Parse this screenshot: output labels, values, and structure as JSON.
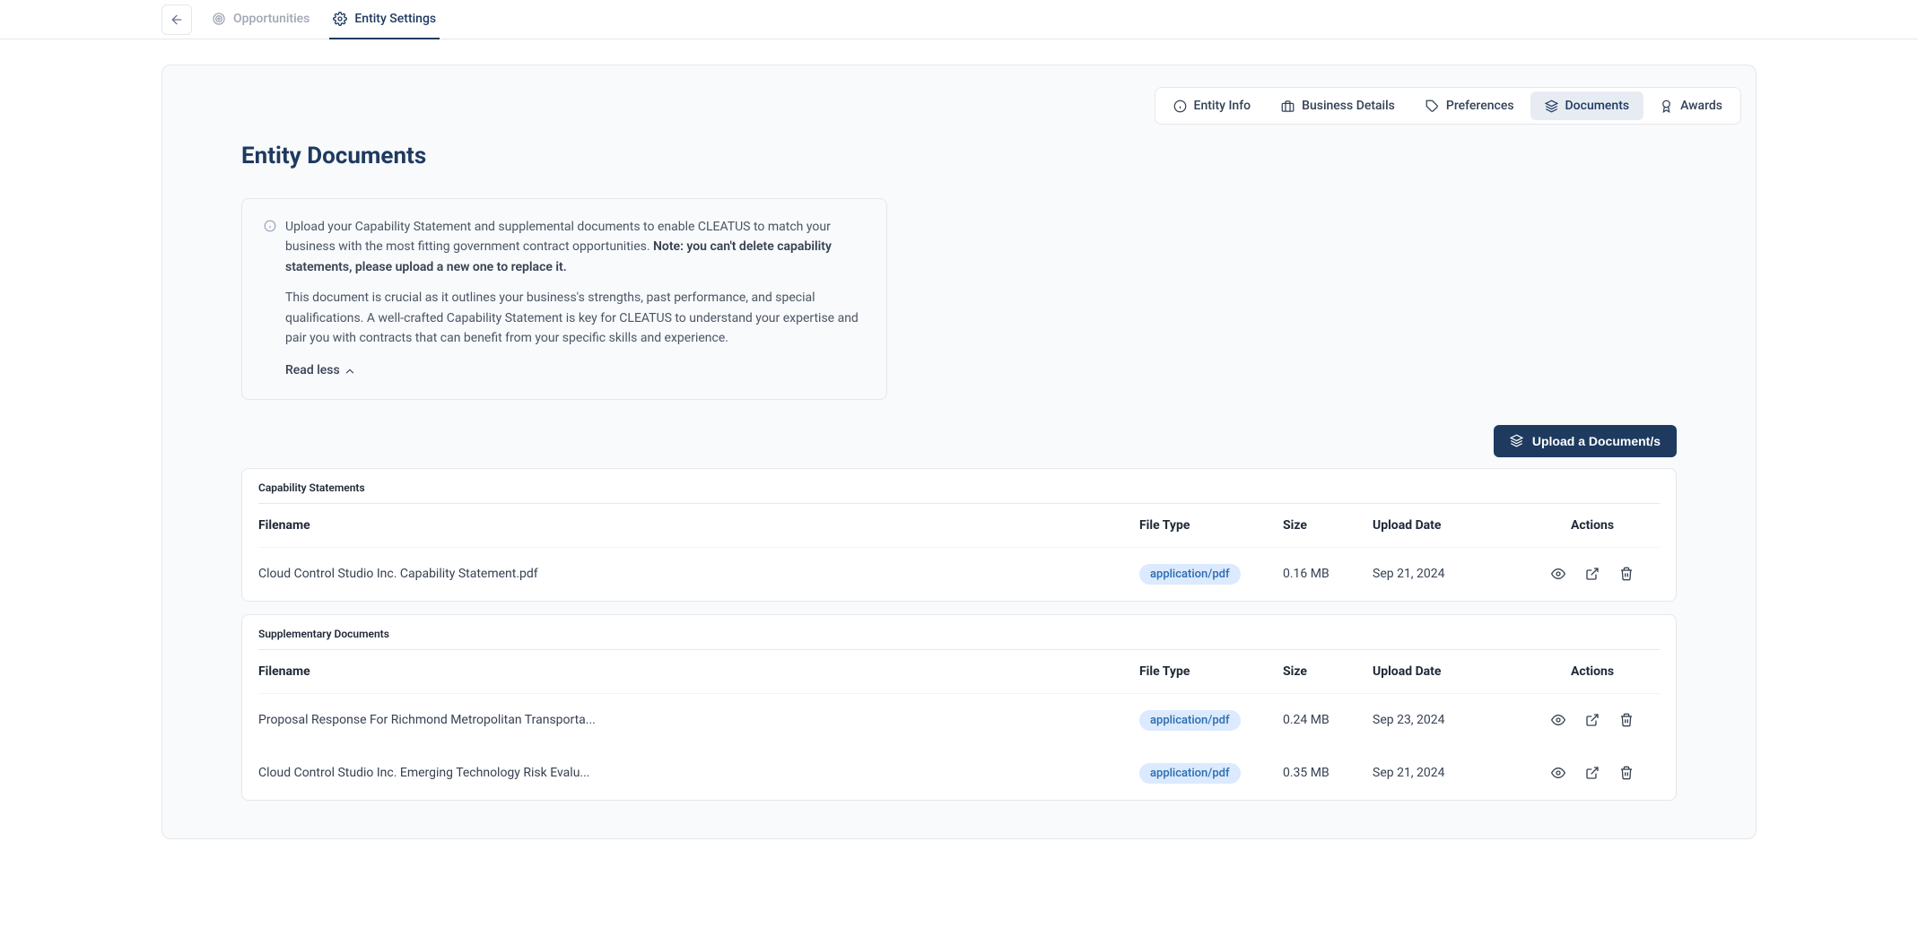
{
  "nav": {
    "opportunities": "Opportunities",
    "entity_settings": "Entity Settings"
  },
  "subnav": {
    "entity_info": "Entity Info",
    "business_details": "Business Details",
    "preferences": "Preferences",
    "documents": "Documents",
    "awards": "Awards"
  },
  "page_title": "Entity Documents",
  "info": {
    "para1_a": "Upload your Capability Statement and supplemental documents to enable CLEATUS to match your business with the most fitting government contract opportunities. ",
    "para1_b": "Note: you can't delete capability statements, please upload a new one to replace it.",
    "para2": "This document is crucial as it outlines your business's strengths, past performance, and special qualifications. A well-crafted Capability Statement is key for CLEATUS to understand your expertise and pair you with contracts that can benefit from your specific skills and experience.",
    "read_less": "Read less"
  },
  "upload_btn": "Upload a Document/s",
  "tables": {
    "headers": {
      "filename": "Filename",
      "file_type": "File Type",
      "size": "Size",
      "upload_date": "Upload Date",
      "actions": "Actions"
    },
    "capability": {
      "title": "Capability Statements",
      "rows": [
        {
          "filename": "Cloud Control Studio Inc. Capability Statement.pdf",
          "file_type": "application/pdf",
          "size": "0.16 MB",
          "upload_date": "Sep 21, 2024"
        }
      ]
    },
    "supplementary": {
      "title": "Supplementary Documents",
      "rows": [
        {
          "filename": "Proposal Response For Richmond Metropolitan Transporta...",
          "file_type": "application/pdf",
          "size": "0.24 MB",
          "upload_date": "Sep 23, 2024"
        },
        {
          "filename": "Cloud Control Studio Inc. Emerging Technology Risk Evalu...",
          "file_type": "application/pdf",
          "size": "0.35 MB",
          "upload_date": "Sep 21, 2024"
        }
      ]
    }
  }
}
